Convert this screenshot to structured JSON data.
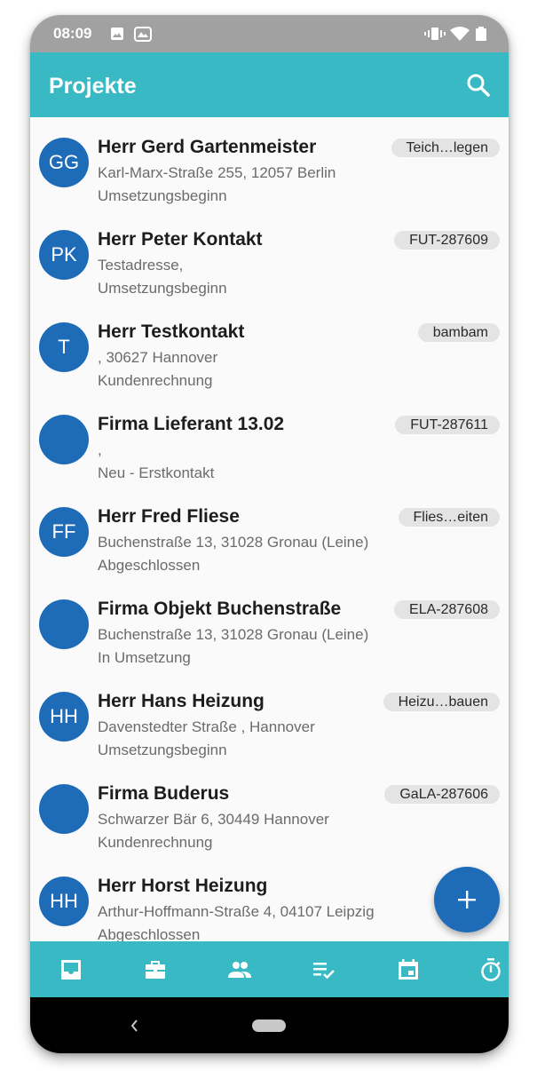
{
  "status_bar": {
    "time": "08:09"
  },
  "app_bar": {
    "title": "Projekte"
  },
  "projects": [
    {
      "initials": "GG",
      "name": "Herr Gerd Gartenmeister",
      "address": "Karl-Marx-Straße 255, 12057 Berlin",
      "status": "Umsetzungsbeginn",
      "badge": "Teich…legen"
    },
    {
      "initials": "PK",
      "name": "Herr Peter Kontakt",
      "address": "Testadresse,",
      "status": "Umsetzungsbeginn",
      "badge": "FUT-287609"
    },
    {
      "initials": "T",
      "name": "Herr Testkontakt",
      "address": ", 30627 Hannover",
      "status": "Kundenrechnung",
      "badge": "bambam"
    },
    {
      "initials": "",
      "name": "Firma Lieferant 13.02",
      "address": ",",
      "status": "Neu - Erstkontakt",
      "badge": "FUT-287611"
    },
    {
      "initials": "FF",
      "name": "Herr Fred Fliese",
      "address": "Buchenstraße 13, 31028 Gronau (Leine)",
      "status": "Abgeschlossen",
      "badge": "Flies…eiten"
    },
    {
      "initials": "",
      "name": "Firma Objekt Buchenstraße",
      "address": "Buchenstraße 13, 31028 Gronau (Leine)",
      "status": "In Umsetzung",
      "badge": "ELA-287608"
    },
    {
      "initials": "HH",
      "name": "Herr Hans  Heizung",
      "address": "Davenstedter Straße ,  Hannover",
      "status": "Umsetzungsbeginn",
      "badge": "Heizu…bauen"
    },
    {
      "initials": "",
      "name": "Firma Buderus",
      "address": "Schwarzer Bär 6, 30449 Hannover",
      "status": "Kundenrechnung",
      "badge": "GaLA-287606"
    },
    {
      "initials": "HH",
      "name": "Herr Horst Heizung",
      "address": "Arthur-Hoffmann-Straße 4, 04107 Leipzig",
      "status": "Abgeschlossen",
      "badge": ""
    }
  ],
  "bottom_nav": {
    "items": [
      {
        "icon": "inbox-icon"
      },
      {
        "icon": "briefcase-icon"
      },
      {
        "icon": "people-icon"
      },
      {
        "icon": "checklist-icon"
      },
      {
        "icon": "calendar-icon"
      },
      {
        "icon": "timer-icon"
      }
    ]
  },
  "colors": {
    "accent": "#38b9c3",
    "avatar": "#1e6bb8",
    "fab": "#1e6bb8",
    "status_bar": "#a1a1a1"
  }
}
